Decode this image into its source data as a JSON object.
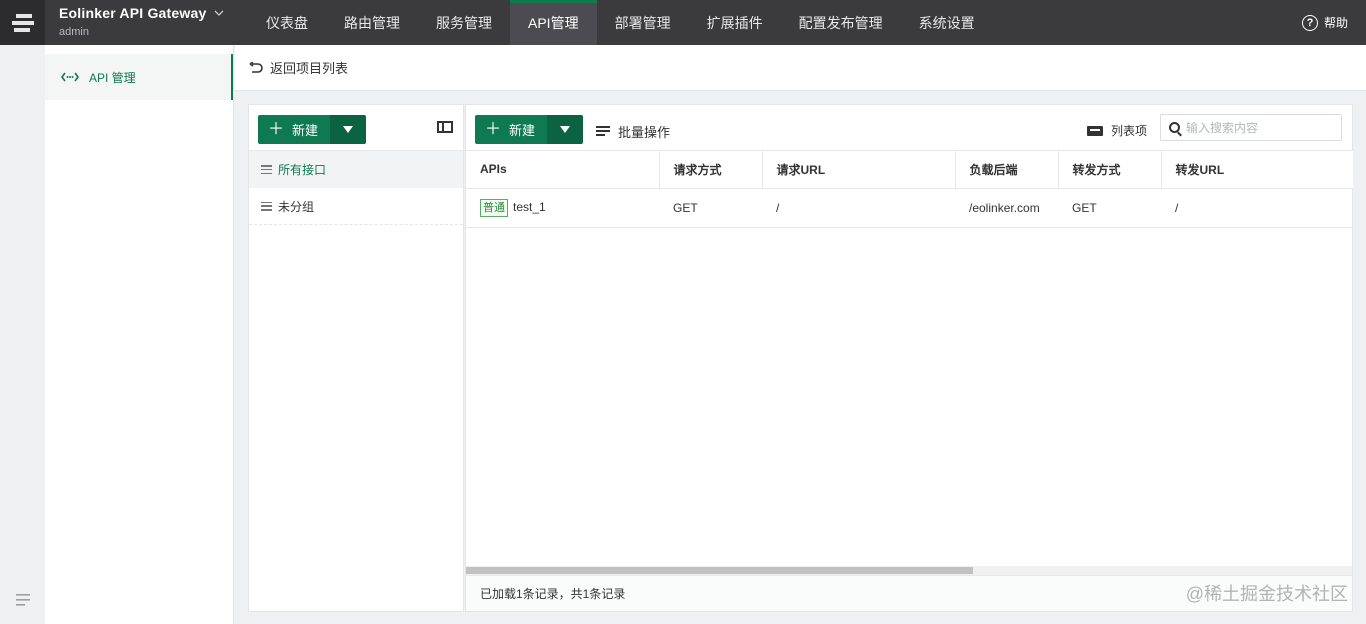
{
  "topbar": {
    "brand_title": "Eolinker API Gateway",
    "user": "admin",
    "nav": [
      "仪表盘",
      "路由管理",
      "服务管理",
      "API管理",
      "部署管理",
      "扩展插件",
      "配置发布管理",
      "系统设置"
    ],
    "active_nav": "API管理",
    "help": "帮助"
  },
  "sidemenu": {
    "item": "API 管理"
  },
  "subheader": {
    "back": "返回项目列表"
  },
  "groups": {
    "new_label": "新建",
    "items": [
      "所有接口",
      "未分组"
    ]
  },
  "apis": {
    "new_label": "新建",
    "batch": "批量操作",
    "columns_label": "列表项",
    "search_placeholder": "输入搜索内容",
    "headers": [
      "APIs",
      "请求方式",
      "请求URL",
      "负载后端",
      "转发方式",
      "转发URL"
    ],
    "rows": [
      {
        "tag": "普通",
        "name": "test_1",
        "method": "GET",
        "url": "/",
        "backend": "/eolinker.com",
        "forward_method": "GET",
        "forward_url": "/"
      }
    ],
    "footer": "已加载1条记录，共1条记录"
  },
  "watermark": "@稀土掘金技术社区",
  "colors": {
    "accent": "#0f7a52",
    "topbar": "#3a3a3f"
  }
}
